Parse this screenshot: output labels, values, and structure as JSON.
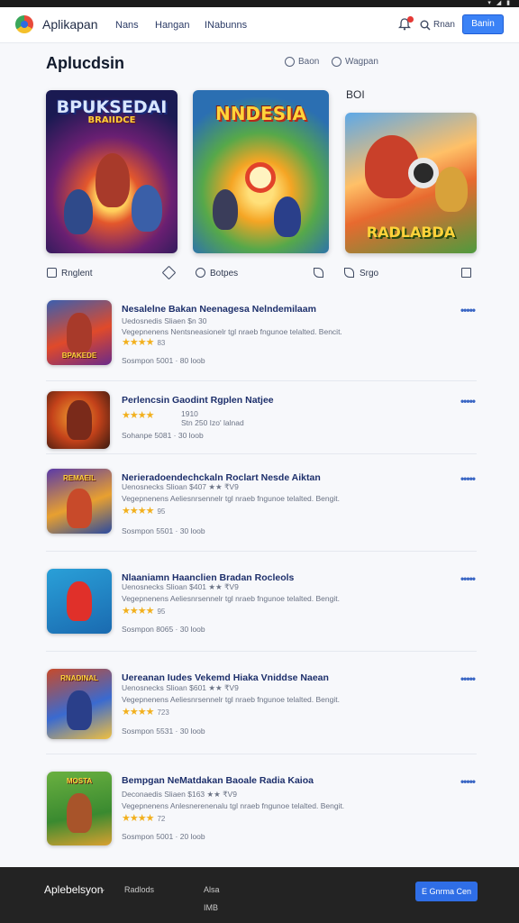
{
  "header": {
    "brand": "Aplikapan",
    "nav": [
      "Nans",
      "Hangan",
      "INabunns"
    ],
    "search_label": "Rnan",
    "signin_label": "Banin"
  },
  "section": {
    "title": "Aplucdsin",
    "actions": [
      "Baon",
      "Wagpan"
    ],
    "year_badge": "BOI"
  },
  "featured": [
    {
      "title": "BPUKSEDAI",
      "subtitle": "BRAIIDCE"
    },
    {
      "title": "NNDESIA"
    },
    {
      "title": "RADLABDA"
    }
  ],
  "action_bar": [
    "Rnglent",
    "Botpes",
    "Srgo"
  ],
  "apps": [
    {
      "title": "Nesalelne Bakan Neenagesa Nelndemilaam",
      "sub1": "Uedosnedis Sliaen $n 30",
      "sub2": "Vegepnenens Nentsneasionelr tgl nraeb fngunoe telalted. Bencit.",
      "stars": "★★★★",
      "rating": "83",
      "meta": "Sosmpon 5001 · 80 loob",
      "thumb_caption": "BPAKEDE",
      "thumb_colors": [
        "#3a5fb0",
        "#e04a2a",
        "#6a2a8a"
      ]
    },
    {
      "title": "Perlencsin Gaodint Rgplen Natjee",
      "sub1": "1910",
      "sub2": "Stn 250 Izo' lalnad",
      "stars": "★★★★",
      "rating": "",
      "meta": "Sohanpe 5081 · 30 loob",
      "thumb_caption": "",
      "thumb_colors": [
        "#f0a030",
        "#c4421a",
        "#3a1a10"
      ]
    },
    {
      "title": "Nerieradoendechckaln Roclart Nesde Aiktan",
      "sub1": "Uenosnecks Slioan $407 ★★ ₹V9",
      "sub2": "Vegepnenens Aeliesnrsennelr tgl nraeb fngunoe telalted. Bengit.",
      "stars": "★★★★",
      "rating": "95",
      "meta": "Sosmpon 5501 · 30 loob",
      "thumb_caption": "REMAEIL",
      "thumb_colors": [
        "#5a3aa8",
        "#e8a030",
        "#2a4aa0"
      ]
    },
    {
      "title": "Nlaaniamn Haanclien Bradan Rocleols",
      "sub1": "Uenosnecks Slioan $401 ★★ ₹V9",
      "sub2": "Vegepnenens Aeliesnrsennelr tgl nraeb fngunoe telalted. Bengit.",
      "stars": "★★★★",
      "rating": "95",
      "meta": "Sosmpon 8065 · 30 loob",
      "thumb_caption": "",
      "thumb_colors": [
        "#2aa0d8",
        "#1a6ab0",
        "#e0302a"
      ]
    },
    {
      "title": "Uereanan Iudes Vekemd Hiaka Vniddse Naean",
      "sub1": "Uenosnecks Slioan $601 ★★ ₹V9",
      "sub2": "Vegepnenens Aeliesnrsennelr tgl nraeb fngunoe telalted. Bengit.",
      "stars": "★★★★",
      "rating": "723",
      "meta": "Sosmpon 5531 · 30 loob",
      "thumb_caption": "RNADINAL",
      "thumb_colors": [
        "#c84a2a",
        "#3a6ad0",
        "#f0c040"
      ]
    },
    {
      "title": "Bempgan NeMatdakan Baoale Radia Kaioa",
      "sub1": "Deconaedis Sliaen $163 ★★ ₹V9",
      "sub2": "Vegepnenens Anlesnerenenalu tgl nraeb fngunoe telalted. Bengit.",
      "stars": "★★★★",
      "rating": "72",
      "meta": "Sosmpon 5001 · 20 loob",
      "thumb_caption": "MOSTA",
      "thumb_colors": [
        "#6ab040",
        "#3a8a30",
        "#d8a030"
      ]
    }
  ],
  "footer": {
    "brand": "Aplebelsyon",
    "links": [
      "Radlods",
      "Alsa",
      "IMB"
    ],
    "button_label": "E Gnrma Cen"
  },
  "colors": {
    "accent": "#3b82f6",
    "title_link": "#1d2f6b",
    "star": "#f2b01e",
    "footer_bg": "#232323"
  }
}
